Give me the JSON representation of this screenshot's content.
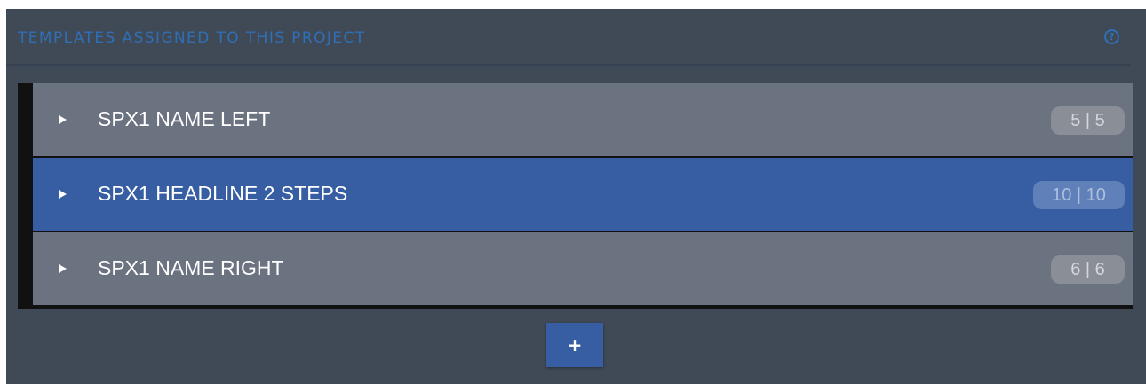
{
  "panel": {
    "title": "TEMPLATES ASSIGNED TO THIS PROJECT",
    "help_icon": "question-circle-icon",
    "help_glyph": "?"
  },
  "templates": [
    {
      "label": "SPX1 NAME LEFT",
      "count": "5 | 5",
      "active": false,
      "icon": "play-icon"
    },
    {
      "label": "SPX1 HEADLINE 2 STEPS",
      "count": "10 | 10",
      "active": true,
      "icon": "play-icon"
    },
    {
      "label": "SPX1 NAME RIGHT",
      "count": "6 | 6",
      "active": false,
      "icon": "play-icon"
    }
  ],
  "add_button": {
    "label": "+",
    "icon": "plus-icon"
  },
  "colors": {
    "panel_background": "#404a57",
    "title_accent": "#2f6fb6",
    "row_background": "#6b7280",
    "row_active_background": "#375ea3",
    "button_background": "#375ea3"
  }
}
